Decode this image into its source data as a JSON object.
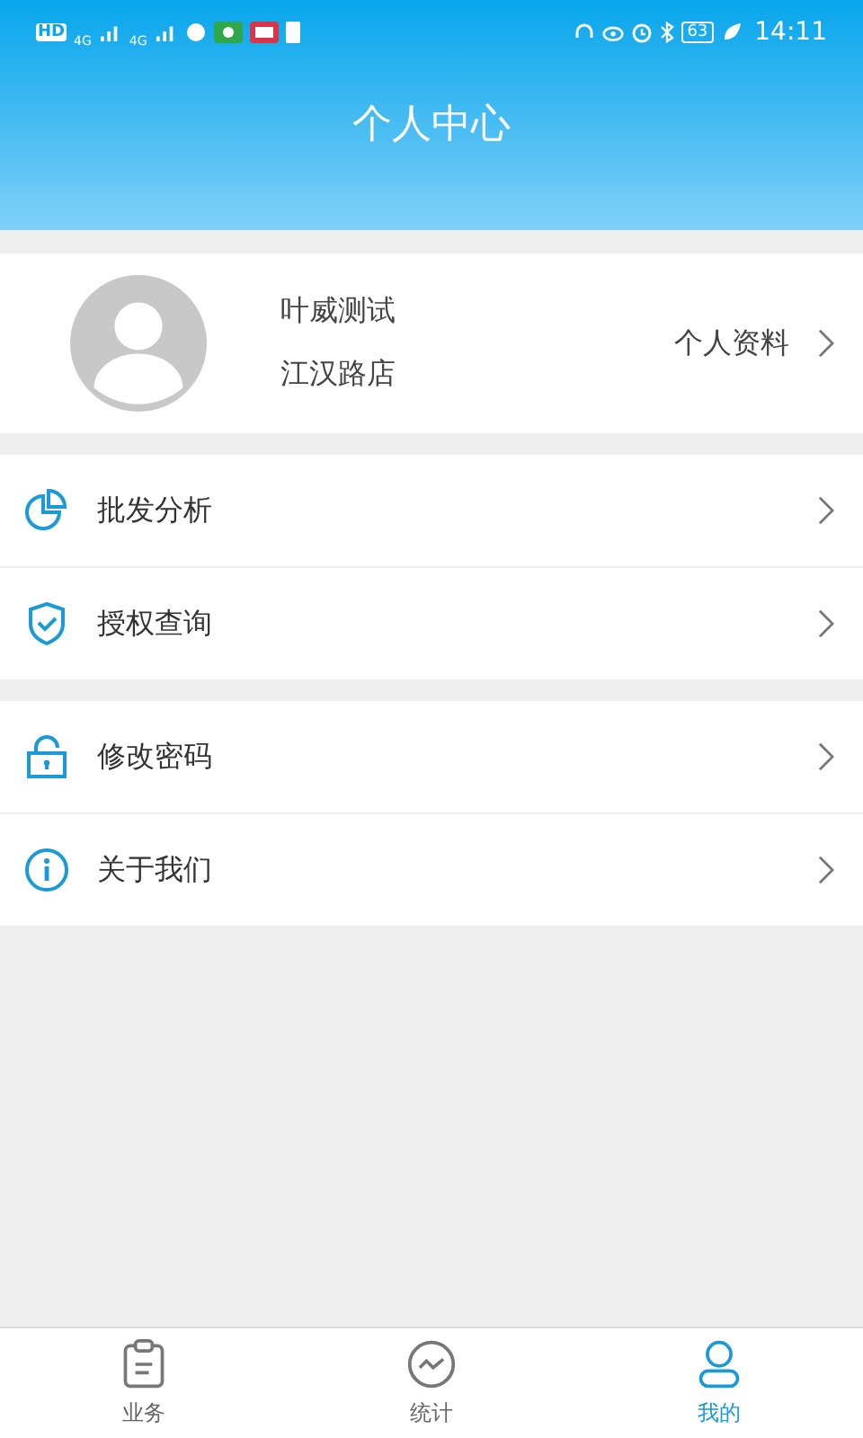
{
  "status_bar": {
    "left": [
      "HD",
      "4G",
      "4G"
    ],
    "battery": "63",
    "time": "14:11"
  },
  "header": {
    "title": "个人中心"
  },
  "profile": {
    "name": "叶威测试",
    "store": "江汉路店",
    "link": "个人资料"
  },
  "menu_groups": [
    [
      {
        "kind": "pie",
        "label": "批发分析"
      },
      {
        "kind": "shield",
        "label": "授权查询"
      }
    ],
    [
      {
        "kind": "lock",
        "label": "修改密码"
      },
      {
        "kind": "info",
        "label": "关于我们"
      }
    ]
  ],
  "tabs": [
    {
      "kind": "clipboard",
      "label": "业务",
      "selected": false
    },
    {
      "kind": "chart",
      "label": "统计",
      "selected": false
    },
    {
      "kind": "person",
      "label": "我的",
      "selected": true
    }
  ]
}
